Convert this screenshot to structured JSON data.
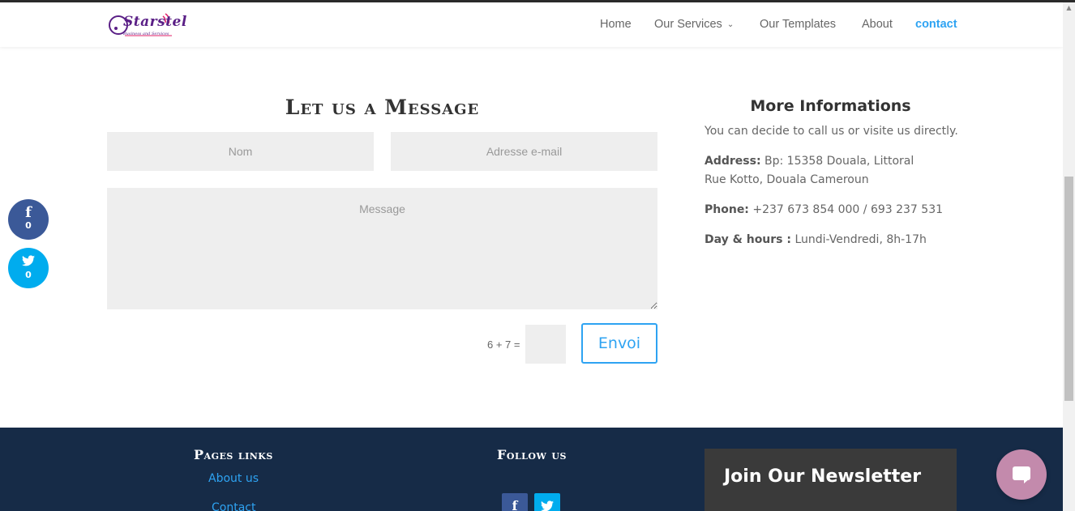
{
  "header": {
    "logo_text": "Starstel",
    "logo_subtext": "Business and Services",
    "nav": [
      {
        "label": "Home"
      },
      {
        "label": "Our Services"
      },
      {
        "label": "Our Templates"
      },
      {
        "label": "About"
      },
      {
        "label": "contact"
      }
    ]
  },
  "contact_form": {
    "title": "Let us a Message",
    "name_placeholder": "Nom",
    "email_placeholder": "Adresse e-mail",
    "message_placeholder": "Message",
    "captcha_label": "6 + 7 =",
    "submit_label": "Envoi"
  },
  "info": {
    "title": "More Informations",
    "intro": "You can decide to call us or visite us directly.",
    "address_label": "Address:",
    "address_line1": "Bp: 15358 Douala, Littoral",
    "address_line2": "Rue Kotto, Douala Cameroun",
    "phone_label": "Phone:",
    "phone_value": "+237  673 854 000 / 693 237 531",
    "hours_label": "Day & hours :",
    "hours_value": "Lundi-Vendredi, 8h-17h"
  },
  "social_float": {
    "facebook_icon": "f",
    "facebook_count": "0",
    "twitter_icon": "t",
    "twitter_count": "0"
  },
  "footer": {
    "pages_heading": "Pages links",
    "links": [
      "About us",
      "Contact"
    ],
    "follow_heading": "Follow us",
    "newsletter_title": "Join Our Newsletter"
  },
  "colors": {
    "accent": "#2ea3f2",
    "footer_bg": "#162b47",
    "facebook": "#3b5998",
    "twitter": "#00acee",
    "chat": "#c38aac"
  }
}
